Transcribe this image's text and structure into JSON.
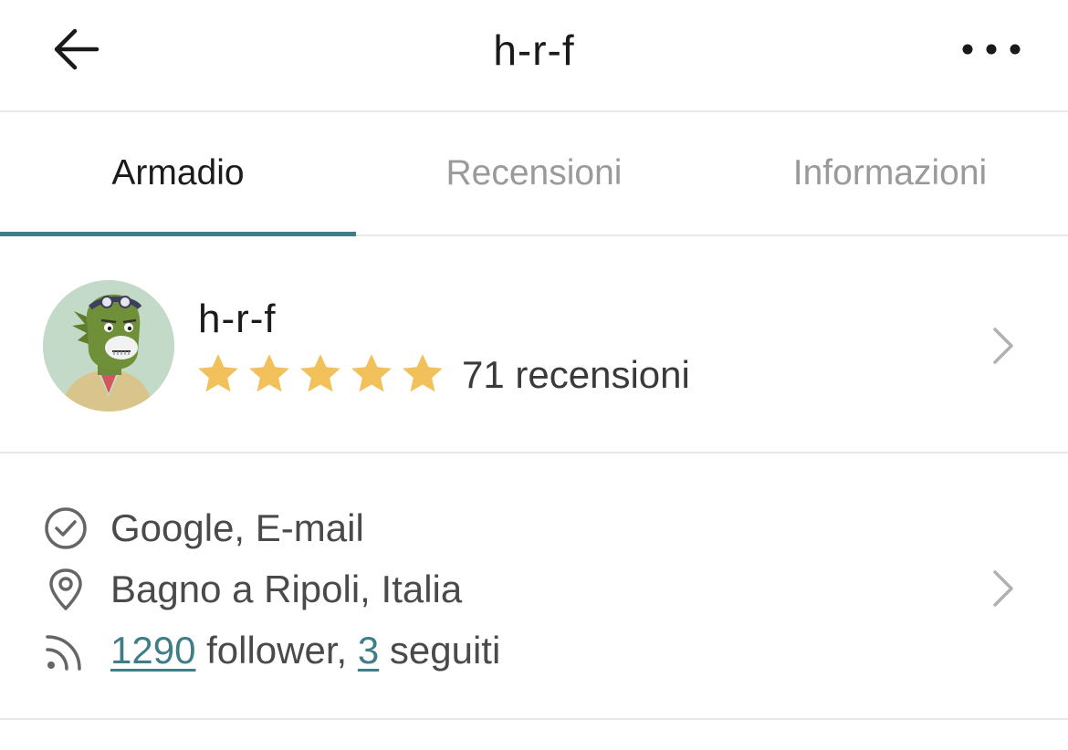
{
  "header": {
    "title": "h-r-f",
    "back_icon": "arrow-left-icon",
    "more_icon": "more-horizontal-icon"
  },
  "tabs": [
    {
      "label": "Armadio",
      "active": true
    },
    {
      "label": "Recensioni",
      "active": false
    },
    {
      "label": "Informazioni",
      "active": false
    }
  ],
  "profile": {
    "username": "h-r-f",
    "rating": 5,
    "max_rating": 5,
    "reviews_label": "71 recensioni",
    "avatar_icon": "avatar-image"
  },
  "info": {
    "verified_label": "Google, E-mail",
    "location_label": "Bagno a Ripoli, Italia",
    "followers_count": "1290",
    "followers_suffix": "follower,",
    "following_count": "3",
    "following_suffix": "seguiti"
  },
  "colors": {
    "accent": "#3f7d87",
    "star": "#f2c15c",
    "divider": "#e8e8e8",
    "muted_text": "#9a9a9a"
  }
}
